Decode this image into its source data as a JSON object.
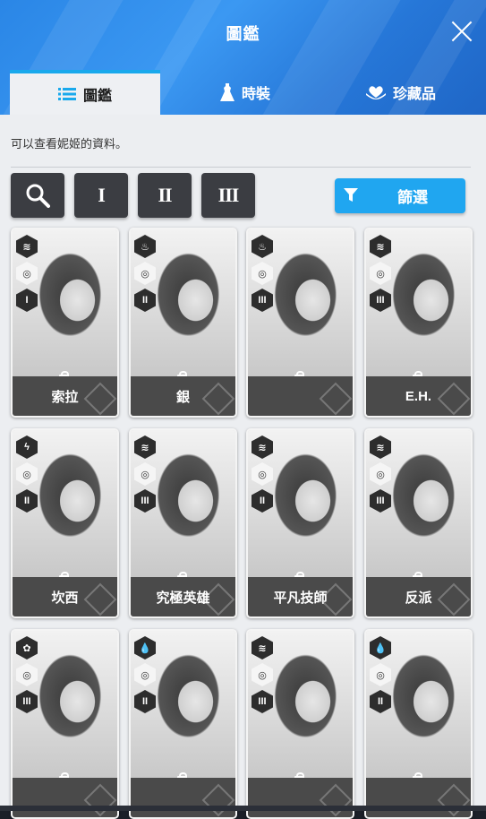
{
  "header": {
    "title": "圖鑑",
    "close": "close-icon"
  },
  "tabs": [
    {
      "label": "圖鑑",
      "icon": "list-icon",
      "active": true
    },
    {
      "label": "時裝",
      "icon": "dress-icon",
      "active": false
    },
    {
      "label": "珍藏品",
      "icon": "heart-hand-icon",
      "active": false
    }
  ],
  "description": "可以查看妮姬的資料。",
  "filters": {
    "search": "search-icon",
    "tier1": "I",
    "tier2": "II",
    "tier3": "III",
    "filter_label": "篩選",
    "filter_icon": "funnel-icon"
  },
  "cards": [
    {
      "name": "索拉",
      "element": "wind",
      "weapon": "SMG",
      "burst": "I"
    },
    {
      "name": "銀",
      "element": "fire",
      "weapon": "AR",
      "burst": "II"
    },
    {
      "name": "",
      "element": "fire",
      "weapon": "SMG",
      "burst": "III"
    },
    {
      "name": "E.H.",
      "element": "wind",
      "weapon": "RL",
      "burst": "III"
    },
    {
      "name": "坎西",
      "element": "electric",
      "weapon": "RL",
      "burst": "II"
    },
    {
      "name": "究極英雄",
      "element": "wind",
      "weapon": "SMG",
      "burst": "III"
    },
    {
      "name": "平凡技師",
      "element": "wind",
      "weapon": "AR",
      "burst": "II"
    },
    {
      "name": "反派",
      "element": "wind",
      "weapon": "SR",
      "burst": "III"
    },
    {
      "name": "",
      "element": "iron",
      "weapon": "AR",
      "burst": "III"
    },
    {
      "name": "",
      "element": "water",
      "weapon": "SG",
      "burst": "II"
    },
    {
      "name": "",
      "element": "wind",
      "weapon": "SG",
      "burst": "III"
    },
    {
      "name": "",
      "element": "water",
      "weapon": "RL",
      "burst": "II"
    }
  ],
  "colors": {
    "accent": "#20a6f0",
    "header": "#2a86e6",
    "panel": "#eceef1"
  }
}
